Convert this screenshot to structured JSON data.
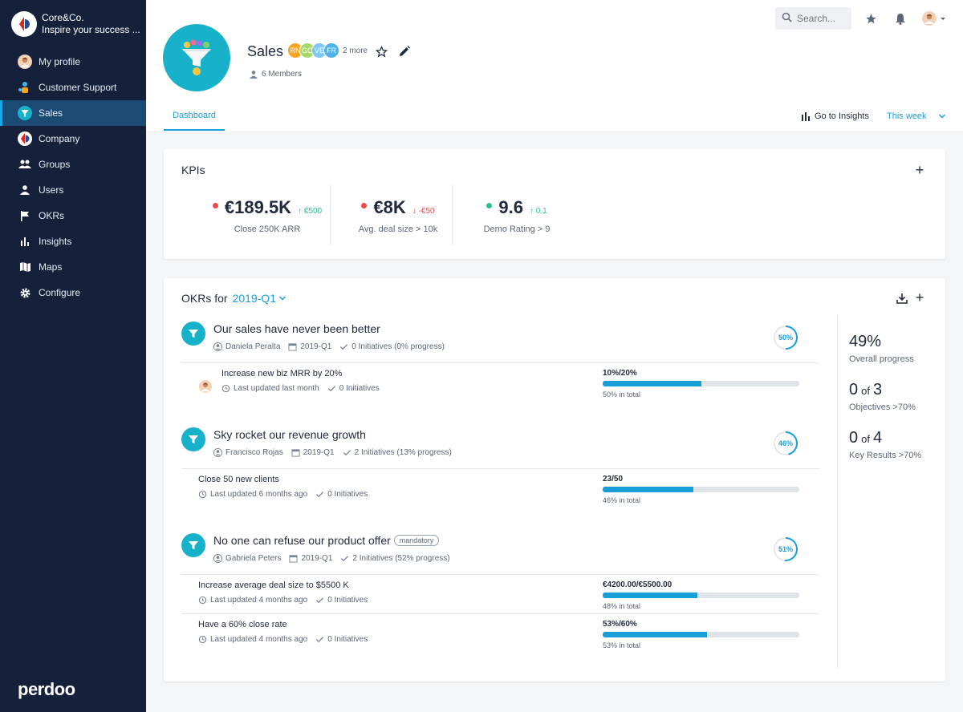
{
  "brand": {
    "name": "Core&Co.",
    "tagline": "Inspire your success ..."
  },
  "nav": [
    {
      "label": "My profile",
      "icon": "avatar-icon"
    },
    {
      "label": "Customer Support",
      "icon": "team-icon"
    },
    {
      "label": "Sales",
      "icon": "funnel-icon",
      "active": true
    },
    {
      "label": "Company",
      "icon": "company-logo-icon"
    },
    {
      "label": "Groups",
      "icon": "groups-icon"
    },
    {
      "label": "Users",
      "icon": "user-icon"
    },
    {
      "label": "OKRs",
      "icon": "flag-icon"
    },
    {
      "label": "Insights",
      "icon": "bar-chart-icon"
    },
    {
      "label": "Maps",
      "icon": "map-icon"
    },
    {
      "label": "Configure",
      "icon": "gear-icon"
    }
  ],
  "footer_logo": "perdoo",
  "header": {
    "search_placeholder": "Search...",
    "team_name": "Sales",
    "member_chips": [
      "RN",
      "GO",
      "VE",
      "FR"
    ],
    "more_members": "2 more",
    "members_count": "6 Members",
    "tab": "Dashboard",
    "go_to_insights": "Go to Insights",
    "period": "This week"
  },
  "kpis": {
    "title": "KPIs",
    "items": [
      {
        "value": "€189.5K",
        "delta": "€500",
        "direction": "up",
        "label": "Close 250K ARR",
        "status_color": "#e94b4b"
      },
      {
        "value": "€8K",
        "delta": "-€50",
        "direction": "down",
        "label": "Avg. deal size > 10k",
        "status_color": "#e94b4b"
      },
      {
        "value": "9.6",
        "delta": "0.1",
        "direction": "up",
        "label": "Demo Rating > 9",
        "status_color": "#2fbf8c"
      }
    ]
  },
  "okrs": {
    "title": "OKRs for",
    "period": "2019-Q1",
    "objectives": [
      {
        "title": "Our sales have never been better",
        "owner": "Daniela Peralta",
        "period": "2019-Q1",
        "initiatives": "0 Initiatives (0% progress)",
        "progress": "50%",
        "progress_value": 50,
        "key_results": [
          {
            "title": "Increase new biz MRR by 20%",
            "updated": "Last updated last month",
            "initiatives": "0 Initiatives",
            "value": "10%/20%",
            "total": "50% in total",
            "progress_value": 50,
            "has_avatar": true
          }
        ]
      },
      {
        "title": "Sky rocket our revenue growth",
        "owner": "Francisco Rojas",
        "period": "2019-Q1",
        "initiatives": "2 Initiatives (13% progress)",
        "progress": "46%",
        "progress_value": 46,
        "key_results": [
          {
            "title": "Close 50 new clients",
            "updated": "Last updated 6 months ago",
            "initiatives": "0 Initiatives",
            "value": "23/50",
            "total": "46% in total",
            "progress_value": 46
          }
        ]
      },
      {
        "title": "No one can refuse our product offer",
        "tag": "mandatory",
        "owner": "Gabriela Peters",
        "period": "2019-Q1",
        "initiatives": "2 Initiatives (52% progress)",
        "progress": "51%",
        "progress_value": 51,
        "key_results": [
          {
            "title": "Increase average deal size to $5500 K",
            "updated": "Last updated 4 months ago",
            "initiatives": "0 Initiatives",
            "value": "€4200.00/€5500.00",
            "total": "48% in total",
            "progress_value": 48
          },
          {
            "title": "Have a 60% close rate",
            "updated": "Last updated 4 months ago",
            "initiatives": "0 Initiatives",
            "value": "53%/60%",
            "total": "53% in total",
            "progress_value": 53
          }
        ]
      }
    ],
    "summary": {
      "overall_value": "49%",
      "overall_label": "Overall progress",
      "objectives_done": "0",
      "objectives_total": "3",
      "objectives_label": "Objectives >70%",
      "krs_done": "0",
      "krs_total": "4",
      "krs_label": "Key Results >70%",
      "of_text": "of"
    }
  },
  "colors": {
    "accent": "#1a9ed8",
    "sidebar": "#15213b",
    "team": "#17b2c9"
  }
}
